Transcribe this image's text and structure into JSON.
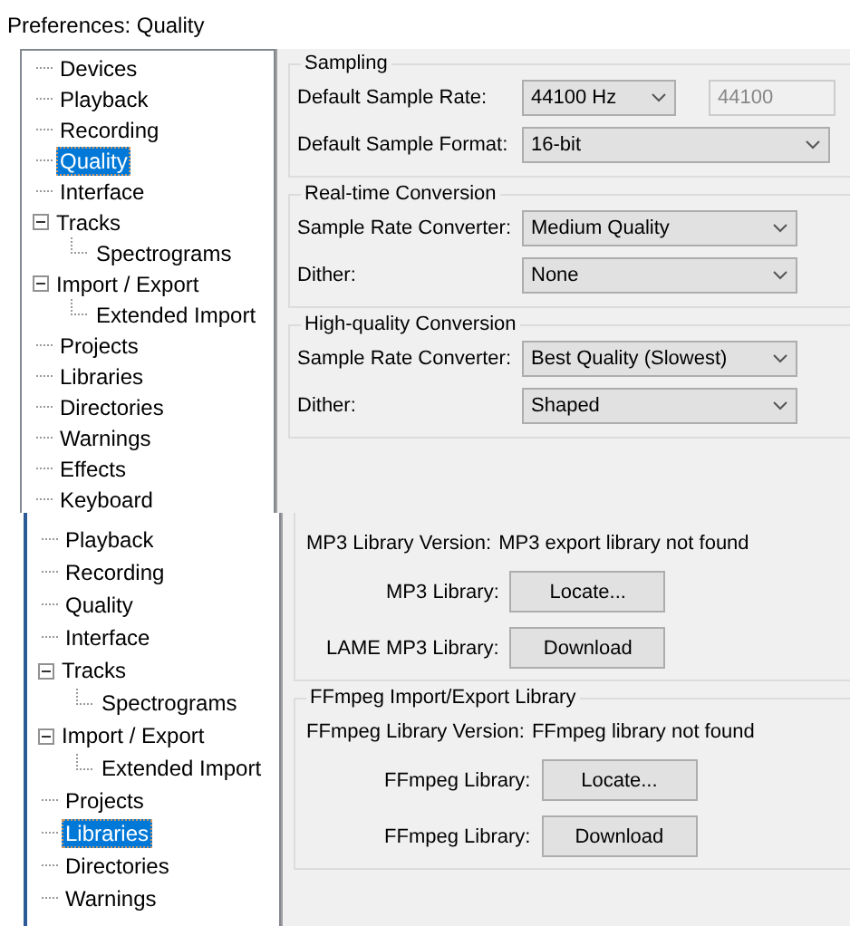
{
  "screens": [
    {
      "title": "Preferences: Quality",
      "tree": [
        {
          "label": "Devices",
          "selected": false
        },
        {
          "label": "Playback",
          "selected": false
        },
        {
          "label": "Recording",
          "selected": false
        },
        {
          "label": "Quality",
          "selected": true
        },
        {
          "label": "Interface",
          "selected": false
        },
        {
          "label": "Tracks",
          "selected": false,
          "expanded": true,
          "children": [
            {
              "label": "Spectrograms",
              "selected": false
            }
          ]
        },
        {
          "label": "Import / Export",
          "selected": false,
          "expanded": true,
          "children": [
            {
              "label": "Extended Import",
              "selected": false
            }
          ]
        },
        {
          "label": "Projects",
          "selected": false
        },
        {
          "label": "Libraries",
          "selected": false
        },
        {
          "label": "Directories",
          "selected": false
        },
        {
          "label": "Warnings",
          "selected": false
        },
        {
          "label": "Effects",
          "selected": false
        },
        {
          "label": "Keyboard",
          "selected": false
        }
      ],
      "panel": {
        "groups": [
          {
            "title": "Sampling",
            "rows": [
              {
                "kind": "combo",
                "label": "Default Sample Rate:",
                "value": "44100 Hz",
                "field": "44100"
              },
              {
                "kind": "dropdown",
                "label": "Default Sample Format:",
                "value": "16-bit"
              }
            ]
          },
          {
            "title": "Real-time Conversion",
            "rows": [
              {
                "kind": "dropdown",
                "label": "Sample Rate Converter:",
                "value": "Medium Quality"
              },
              {
                "kind": "dropdown",
                "label": "Dither:",
                "value": "None"
              }
            ]
          },
          {
            "title": "High-quality Conversion",
            "rows": [
              {
                "kind": "dropdown",
                "label": "Sample Rate Converter:",
                "value": "Best Quality (Slowest)"
              },
              {
                "kind": "dropdown",
                "label": "Dither:",
                "value": "Shaped"
              }
            ]
          }
        ]
      }
    },
    {
      "tree": [
        {
          "label": "Playback",
          "selected": false
        },
        {
          "label": "Recording",
          "selected": false
        },
        {
          "label": "Quality",
          "selected": false
        },
        {
          "label": "Interface",
          "selected": false
        },
        {
          "label": "Tracks",
          "selected": false,
          "expanded": true,
          "children": [
            {
              "label": "Spectrograms",
              "selected": false
            }
          ]
        },
        {
          "label": "Import / Export",
          "selected": false,
          "expanded": true,
          "children": [
            {
              "label": "Extended Import",
              "selected": false
            }
          ]
        },
        {
          "label": "Projects",
          "selected": false
        },
        {
          "label": "Libraries",
          "selected": true
        },
        {
          "label": "Directories",
          "selected": false
        },
        {
          "label": "Warnings",
          "selected": false
        }
      ],
      "panel": {
        "groups": [
          {
            "rows": [
              {
                "kind": "text",
                "label": "MP3 Library Version:",
                "value": "MP3 export library not found"
              },
              {
                "kind": "button",
                "label": "MP3 Library:",
                "button": "Locate..."
              },
              {
                "kind": "button",
                "label": "LAME MP3 Library:",
                "button": "Download"
              }
            ]
          },
          {
            "title": "FFmpeg Import/Export Library",
            "rows": [
              {
                "kind": "text",
                "label": "FFmpeg Library Version:",
                "value": "FFmpeg library not found"
              },
              {
                "kind": "button",
                "label": "FFmpeg Library:",
                "button": "Locate..."
              },
              {
                "kind": "button",
                "label": "FFmpeg Library:",
                "button": "Download"
              }
            ]
          }
        ]
      }
    }
  ]
}
